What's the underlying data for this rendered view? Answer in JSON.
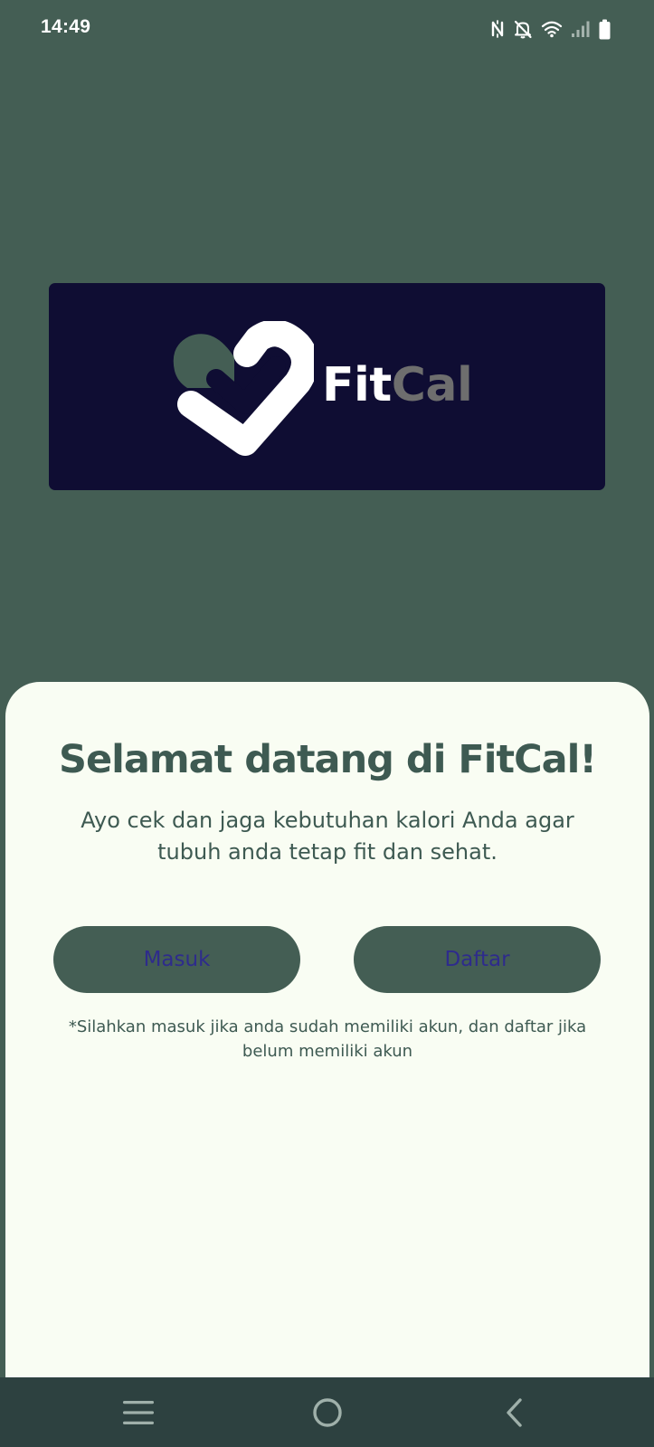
{
  "status_bar": {
    "time": "14:49",
    "icons": [
      "nfc-icon",
      "bell-off-icon",
      "wifi-icon",
      "signal-icon",
      "battery-icon"
    ]
  },
  "logo": {
    "word_primary": "Fit",
    "word_secondary": "Cal",
    "colors": {
      "background": "#0f0d33",
      "primary": "#ffffff",
      "secondary": "#6e6e6e",
      "accent": "#445e54"
    }
  },
  "welcome": {
    "title": "Selamat datang di FitCal!",
    "subtitle": "Ayo cek dan jaga kebutuhan kalori Anda agar tubuh anda tetap fit dan sehat."
  },
  "actions": {
    "login_label": "Masuk",
    "register_label": "Daftar"
  },
  "hint": "*Silahkan masuk jika anda sudah memiliki akun, dan daftar jika belum memiliki akun",
  "nav_bar": {
    "icons": [
      "menu-icon",
      "home-icon",
      "back-icon"
    ]
  },
  "colors": {
    "app_background": "#445e54",
    "sheet_background": "#f9fdf3",
    "text_primary": "#3e5a52",
    "button_background": "#445e54",
    "button_text": "#2e2b8c",
    "nav_background": "#2d4140"
  }
}
